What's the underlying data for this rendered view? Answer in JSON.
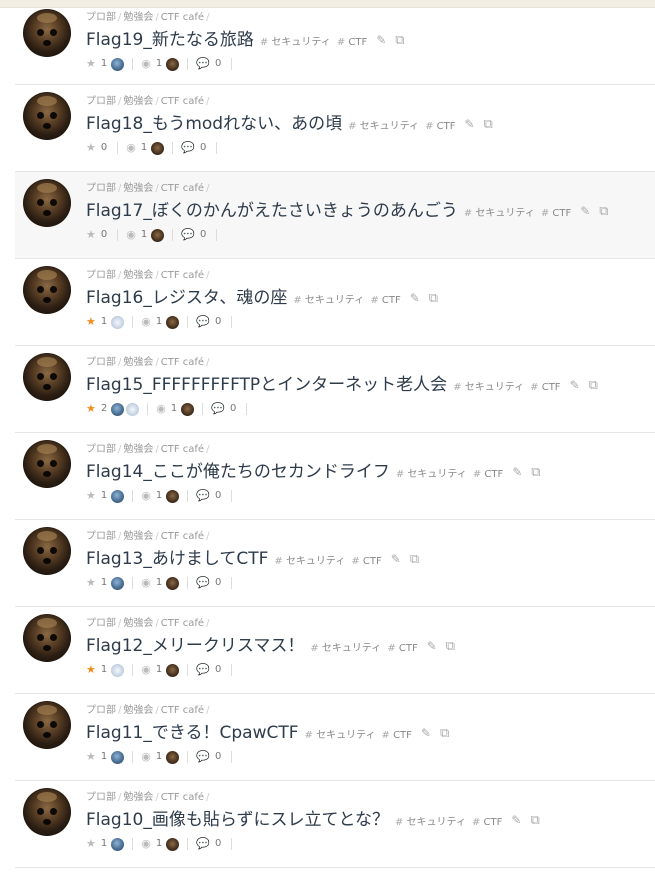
{
  "crumbs": [
    "プロ部",
    "勉強会",
    "CTF café"
  ],
  "tags": [
    "セキュリティ",
    "CTF"
  ],
  "icons": {
    "star": "star-icon",
    "view": "eye-icon",
    "comment": "comment-icon",
    "edit": "pencil-icon",
    "copy": "copy-icon"
  },
  "posts": [
    {
      "title": "Flag19_新たなる旅路",
      "stars": "1",
      "starred": false,
      "stargazers": [
        "blue"
      ],
      "views": "1",
      "comments": "0"
    },
    {
      "title": "Flag18_もうmodれない、あの頃",
      "stars": "0",
      "starred": false,
      "stargazers": [],
      "views": "1",
      "comments": "0"
    },
    {
      "title": "Flag17_ぼくのかんがえたさいきょうのあんごう",
      "stars": "0",
      "starred": false,
      "stargazers": [],
      "views": "1",
      "comments": "0"
    },
    {
      "title": "Flag16_レジスタ、魂の座",
      "stars": "1",
      "starred": true,
      "stargazers": [
        "pale"
      ],
      "views": "1",
      "comments": "0"
    },
    {
      "title": "Flag15_FFFFFFFFFTPとインターネット老人会",
      "stars": "2",
      "starred": true,
      "stargazers": [
        "blue",
        "pale"
      ],
      "views": "1",
      "comments": "0"
    },
    {
      "title": "Flag14_ここが俺たちのセカンドライフ",
      "stars": "1",
      "starred": false,
      "stargazers": [
        "blue"
      ],
      "views": "1",
      "comments": "0"
    },
    {
      "title": "Flag13_あけましてCTF",
      "stars": "1",
      "starred": false,
      "stargazers": [
        "blue"
      ],
      "views": "1",
      "comments": "0"
    },
    {
      "title": "Flag12_メリークリスマス！",
      "stars": "1",
      "starred": true,
      "stargazers": [
        "pale"
      ],
      "views": "1",
      "comments": "0"
    },
    {
      "title": "Flag11_できる！CpawCTF",
      "stars": "1",
      "starred": false,
      "stargazers": [
        "blue"
      ],
      "views": "1",
      "comments": "0"
    },
    {
      "title": "Flag10_画像も貼らずにスレ立てとな？",
      "stars": "1",
      "starred": false,
      "stargazers": [
        "blue"
      ],
      "views": "1",
      "comments": "0"
    }
  ]
}
